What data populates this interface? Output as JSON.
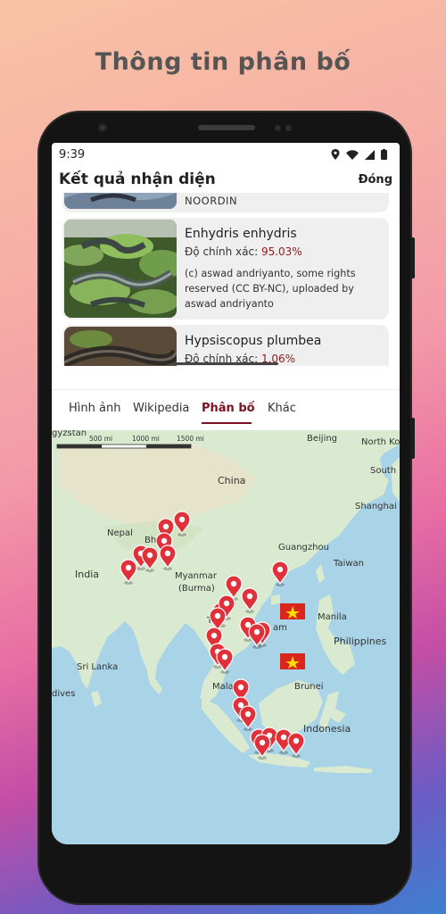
{
  "headline": "Thông tin phân bố",
  "status": {
    "time": "9:39"
  },
  "appbar": {
    "title": "Kết quả nhận diện",
    "close_label": "Đóng"
  },
  "results": {
    "partial_caption": "NOORDIN",
    "accuracy_label": "Độ chính xác:",
    "items": [
      {
        "name": "Enhydris enhydris",
        "accuracy": "95.03%",
        "credit": "(c) aswad andriyanto, some rights reserved (CC BY-NC), uploaded by aswad andriyanto"
      },
      {
        "name": "Hypsiscopus plumbea",
        "accuracy": "1.06%"
      }
    ]
  },
  "tabs": [
    {
      "label": "Hình ảnh"
    },
    {
      "label": "Wikipedia"
    },
    {
      "label": "Phân bố",
      "active": true
    },
    {
      "label": "Khác"
    }
  ],
  "map": {
    "scale_labels": [
      "500 mi",
      "1000 mi",
      "1500 mi"
    ],
    "places": {
      "kyrgyzstan": "gyzstan",
      "beijing": "Beijing",
      "north_korea": "North Ko",
      "south_korea": "South K",
      "china": "China",
      "shanghai": "Shanghai",
      "nepal": "Nepal",
      "bhutan": "Bhu",
      "bangladesh": "Ba",
      "india": "India",
      "guangzhou": "Guangzhou",
      "taiwan": "Taiwan",
      "myanmar1": "Myanmar",
      "myanmar2": "(Burma)",
      "thailand": "Th",
      "vietnam": "am",
      "manila": "Manila",
      "philippines": "Philippines",
      "sri_lanka": "Sri Lanka",
      "maldives": "dives",
      "malaysia": "Mala",
      "brunei": "Brunei",
      "indonesia": "Indonesia"
    },
    "colors": {
      "water": "#a9d3e6",
      "land": "#d9ead0",
      "pin": "#e0303a"
    }
  }
}
